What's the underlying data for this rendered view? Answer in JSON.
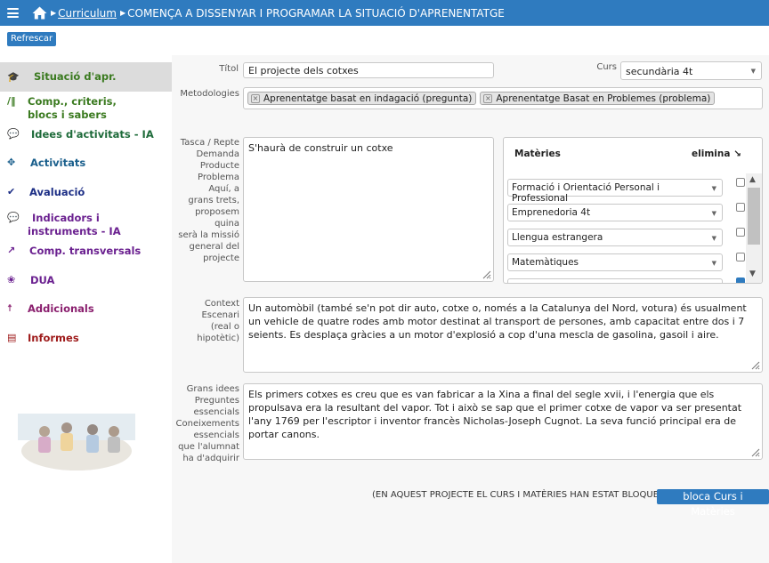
{
  "header": {
    "breadcrumb_link": "Curriculum",
    "title": "COMENÇA A DISSENYAR I PROGRAMAR LA SITUACIÓ D'APRENENTATGE"
  },
  "toolbar": {
    "refresh_label": "Refrescar"
  },
  "sidebar": {
    "items": [
      {
        "label": "Situació d'apr.",
        "icon": "graduation-cap-icon",
        "color": "#3a7a1f",
        "active": true
      },
      {
        "label": "Comp., criteris, blocs i sabers",
        "label_line1": "Comp., criteris,",
        "label_line2": "blocs i sabers",
        "icon": "bars-icon",
        "color": "#3a7a1f"
      },
      {
        "label": "Idees d'activitats - IA",
        "icon": "chat-icon",
        "color": "#1e6b3a"
      },
      {
        "label": "Activitats",
        "icon": "move-arrows-icon",
        "color": "#1a5f8c"
      },
      {
        "label": "Avaluació",
        "icon": "double-check-icon",
        "color": "#1d2f86"
      },
      {
        "label": "Indicadors i instruments - IA",
        "label_line1": "Indicadors i",
        "label_line2": "instruments - IA",
        "icon": "chat-icon",
        "color": "#6b2190"
      },
      {
        "label": "Comp. transversals",
        "icon": "external-link-icon",
        "color": "#6b2190"
      },
      {
        "label": "DUA",
        "icon": "brain-icon",
        "color": "#6b2190"
      },
      {
        "label": "Addicionals",
        "icon": "person-icon",
        "color": "#8a1f6e"
      },
      {
        "label": "Informes",
        "icon": "document-icon",
        "color": "#9e1a1a"
      }
    ]
  },
  "form": {
    "titol_label": "Títol",
    "titol_value": "El projecte dels cotxes",
    "curs_label": "Curs",
    "curs_value": "secundària 4t",
    "metodologies_label": "Metodologies",
    "metodologies": [
      "Aprenentatge basat en indagació (pregunta)",
      "Aprenentatge Basat en Problemes (problema)"
    ],
    "tasca_label_lines": [
      "Tasca / Repte",
      "Demanda",
      "Producte",
      "Problema",
      "Aquí, a",
      "grans trets,",
      "proposem quina",
      "serà la missió",
      "general del",
      "projecte"
    ],
    "tasca_value": "S'haurà de construir un cotxe",
    "context_label_lines": [
      "Context",
      "Escenari",
      "(real o hipotètic)"
    ],
    "context_value": "Un automòbil (també se'n pot dir auto, cotxe o, només a la Catalunya del Nord, votura) és usualment un vehicle de quatre rodes amb motor destinat al transport de persones, amb capacitat entre dos i 7 seients. Es desplaça gràcies a un motor d'explosió a cop d'una mescla de gasolina, gasoil i aire.",
    "grans_idees_label_lines": [
      "Grans idees",
      "Preguntes",
      "essencials",
      "Coneixements",
      "essencials",
      "que l'alumnat",
      "ha d'adquirir"
    ],
    "grans_idees_value": "Els primers cotxes es creu que es van fabricar a la Xina a final del segle xvii, i l'energia que els propulsava era la resultant del vapor. Tot i això se sap que el primer cotxe de vapor va ser presentat l'any 1769 per l'escriptor i inventor francès Nicholas-Joseph Cugnot. La seva funció principal era de portar canons."
  },
  "materies": {
    "header": "Matèries",
    "delete_header": "elimina ↘",
    "items": [
      "Formació i Orientació Personal i Professional",
      "Emprenedoria 4t",
      "Llengua estrangera",
      "Matemàtiques"
    ]
  },
  "footer": {
    "note": "(EN AQUEST PROJECTE EL CURS I MATÈRIES HAN ESTAT BLOQUEJATS)",
    "lock_label": "bloca Curs i Matèries"
  },
  "colors": {
    "header_bg": "#2f7bbf",
    "button_bg": "#2f7bbf",
    "active_nav_bg": "#dcdcdc",
    "main_bg": "#f7f7f7"
  }
}
